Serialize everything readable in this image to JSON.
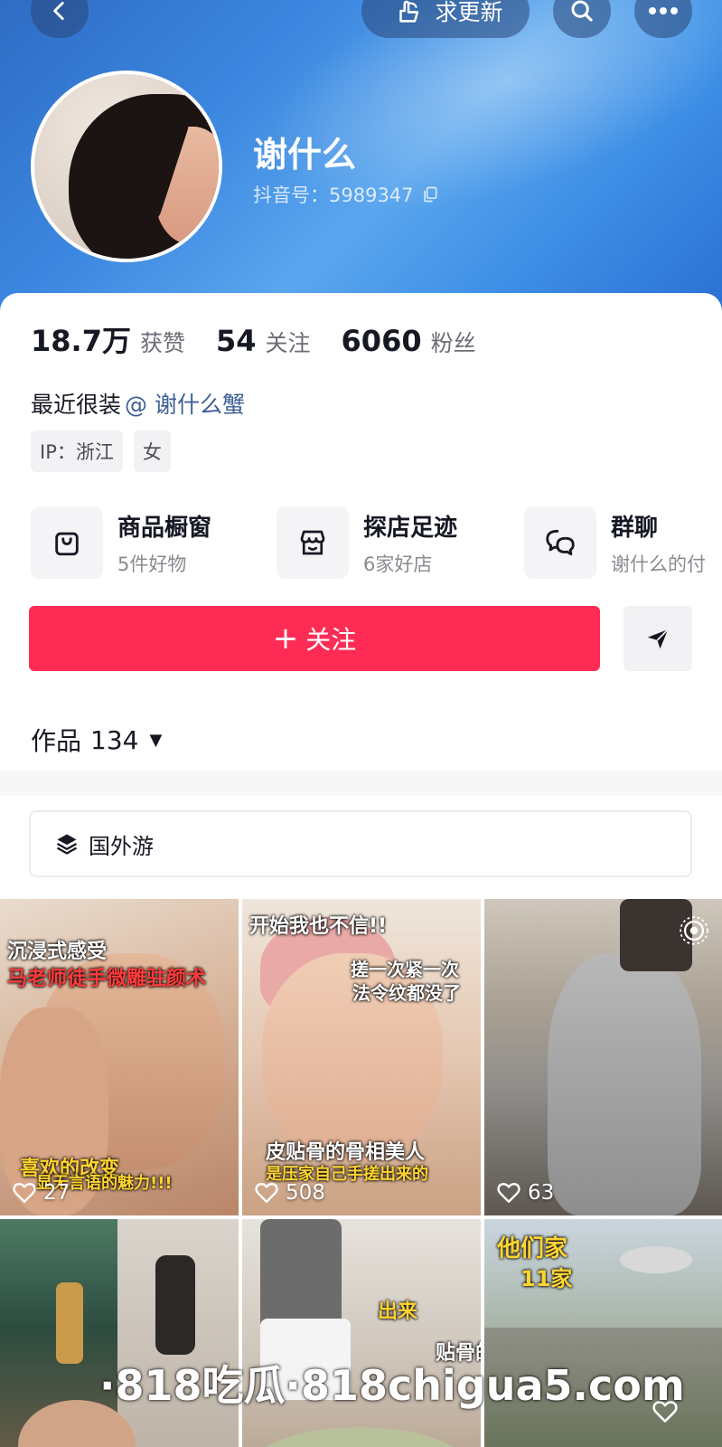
{
  "header": {
    "update_label": "求更新",
    "name": "谢什么",
    "douyin_id": "抖音号：5989347"
  },
  "stats": [
    {
      "value": "18.7万",
      "label": "获赞"
    },
    {
      "value": "54",
      "label": "关注"
    },
    {
      "value": "6060",
      "label": "粉丝"
    }
  ],
  "bio": {
    "text": "最近很装",
    "mention": "@ 谢什么蟹"
  },
  "tags": [
    "IP：浙江",
    "女"
  ],
  "features": [
    {
      "title": "商品橱窗",
      "subtitle": "5件好物",
      "icon": "bag-icon"
    },
    {
      "title": "探店足迹",
      "subtitle": "6家好店",
      "icon": "shop-icon"
    },
    {
      "title": "群聊",
      "subtitle": "谢什么的付",
      "icon": "chat-icon"
    }
  ],
  "follow": {
    "plus": "+",
    "label": "关注"
  },
  "works": {
    "label": "作品",
    "count": "134",
    "caret": "▼"
  },
  "collection": {
    "label": "国外游"
  },
  "videos": [
    {
      "likes": "27",
      "captions": [
        "沉浸式感受",
        "马老师徒手微雕驻颜术",
        "喜欢的改变",
        "显无言语的魅力!!!"
      ]
    },
    {
      "likes": "508",
      "captions": [
        "开始我也不信!!",
        "搓一次紧一次",
        "法令纹都没了",
        "皮贴骨的骨相美人",
        "是压家自己手搓出来的"
      ]
    },
    {
      "likes": "63",
      "captions": []
    },
    {
      "likes": "",
      "captions": []
    },
    {
      "likes": "",
      "captions": [
        "出来",
        "贴骨的骨相美人"
      ]
    },
    {
      "likes": "",
      "captions": [
        "他们家",
        "11家"
      ]
    }
  ],
  "watermark": "·818吃瓜·818chigua5.com",
  "colors": {
    "accent": "#fe2c55",
    "header_blue": "#3b86df",
    "mention": "#3d5f96"
  }
}
